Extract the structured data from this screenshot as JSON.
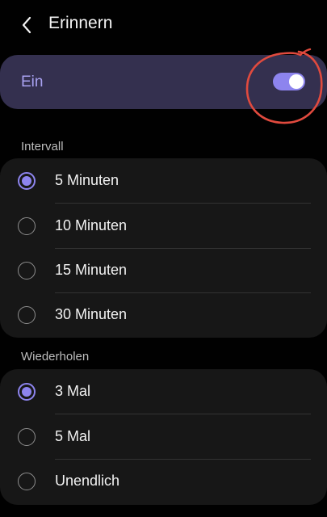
{
  "header": {
    "title": "Erinnern",
    "back_icon": "chevron-left-icon"
  },
  "master_switch": {
    "label": "Ein",
    "state": "on",
    "accent_color": "#8d84ee",
    "background_color": "#34304f"
  },
  "annotation": {
    "type": "hand-drawn circle around toggle",
    "color": "#e04a3e"
  },
  "interval": {
    "header": "Intervall",
    "options": [
      {
        "label": "5 Minuten",
        "selected": true
      },
      {
        "label": "10 Minuten",
        "selected": false
      },
      {
        "label": "15 Minuten",
        "selected": false
      },
      {
        "label": "30 Minuten",
        "selected": false
      }
    ]
  },
  "repeat": {
    "header": "Wiederholen",
    "options": [
      {
        "label": "3 Mal",
        "selected": true
      },
      {
        "label": "5 Mal",
        "selected": false
      },
      {
        "label": "Unendlich",
        "selected": false
      }
    ]
  }
}
